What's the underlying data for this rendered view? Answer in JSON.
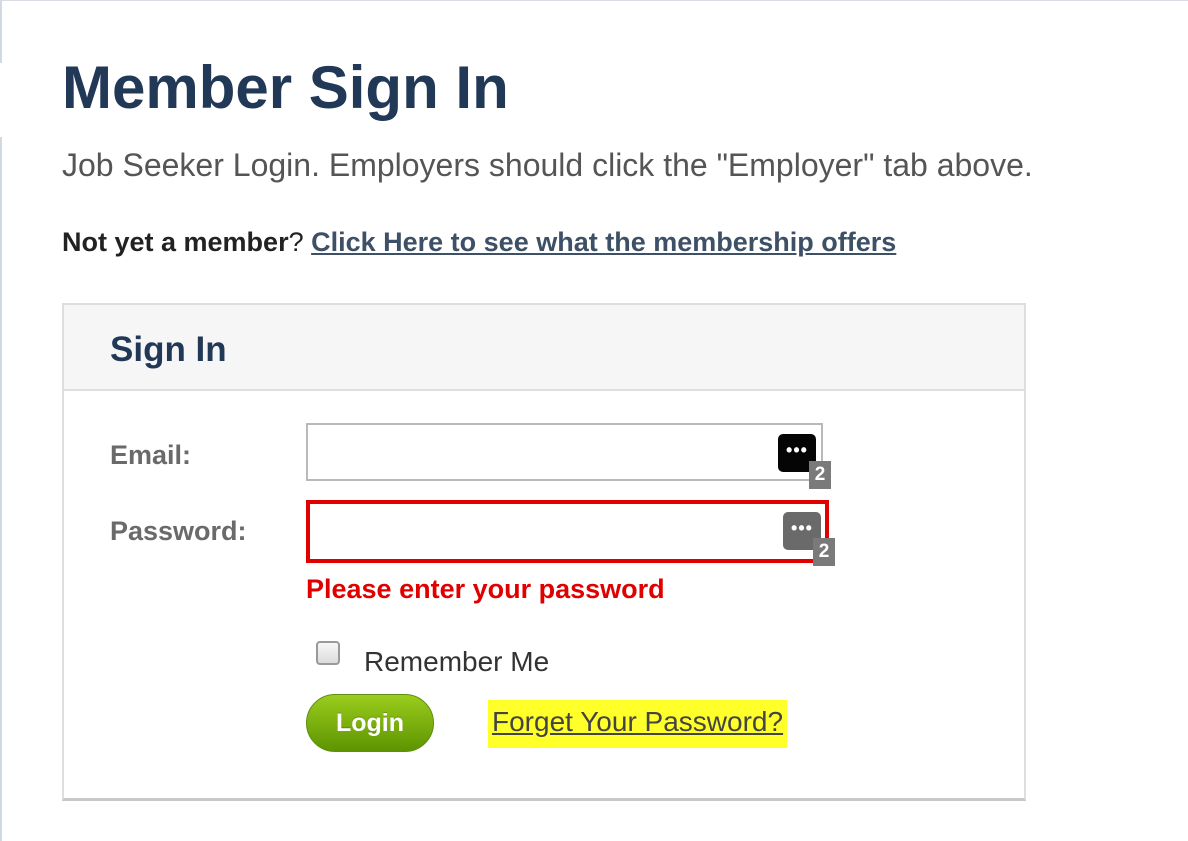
{
  "page": {
    "title": "Member Sign In",
    "subtitle": "Job Seeker Login. Employers should click the \"Employer\" tab above.",
    "not_member_bold": "Not yet a member",
    "not_member_rest": "? ",
    "membership_link": "Click Here to see what the membership offers"
  },
  "signin": {
    "panel_title": "Sign In",
    "email_label": "Email:",
    "password_label": "Password:",
    "email_value": "",
    "password_value": "",
    "password_manager_icon": "ellipsis-key-icon",
    "password_manager_count": "2",
    "error_message": "Please enter your password",
    "remember_label": "Remember Me",
    "login_label": "Login",
    "forgot_label": "Forget Your Password?"
  },
  "colors": {
    "heading": "#213856",
    "error": "#e00000",
    "login_button": "#7ab30f",
    "forgot_highlight": "#ffff29"
  }
}
